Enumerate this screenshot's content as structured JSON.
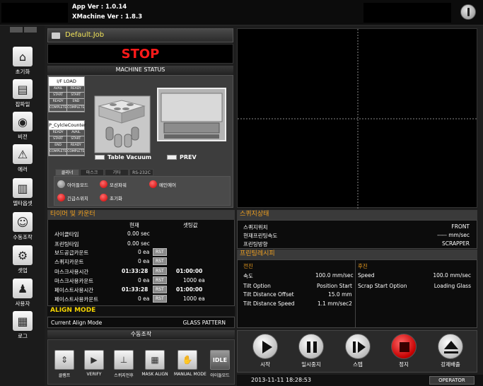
{
  "app": {
    "app_version": "App Ver : 1.0.14",
    "xmachine_version": "XMachine Ver : 1.8.3"
  },
  "sidebar": {
    "mini_left": "",
    "mini_right": "",
    "items": [
      {
        "label": "초기화",
        "icon": "home-icon"
      },
      {
        "label": "잡파일",
        "icon": "folder-icon"
      },
      {
        "label": "비전",
        "icon": "camera-icon"
      },
      {
        "label": "에러",
        "icon": "warning-icon"
      },
      {
        "label": "델타옵셋",
        "icon": "ruler-icon"
      },
      {
        "label": "수동조작",
        "icon": "user-hand-icon"
      },
      {
        "label": "셋업",
        "icon": "gear-icon"
      },
      {
        "label": "사용자",
        "icon": "user-icon"
      },
      {
        "label": "로그",
        "icon": "document-icon"
      }
    ]
  },
  "job": {
    "name": "Default.Job"
  },
  "status": {
    "text": "STOP",
    "color": "#ff1a1a"
  },
  "machine_status": {
    "title": "MACHINE STATUS",
    "if_load": {
      "title": "I/F LOAD",
      "cells": [
        "AVAIL",
        "READY",
        "START",
        "START",
        "READY",
        "END",
        "COMPLETE",
        "COMPLETE"
      ]
    },
    "cycle_counter": {
      "title": "P_CylcleCounter",
      "cells": [
        "READY",
        "AVAIL",
        "START",
        "START",
        "END",
        "READY",
        "COMPLETE",
        "COMPLETE"
      ]
    },
    "table_vacuum": "Table Vacuum",
    "prev": "PREV",
    "tabs": [
      "클리너",
      "마스크",
      "기타",
      "RS-232C"
    ],
    "switches": [
      {
        "label": "아이들모드",
        "state": "gray"
      },
      {
        "label": "모션파워",
        "state": "red"
      },
      {
        "label": "메인에어",
        "state": "red"
      },
      {
        "label": "긴급스위치",
        "state": "red"
      },
      {
        "label": "초기화",
        "state": "red"
      }
    ]
  },
  "timer": {
    "title": "타이머 및 카운터",
    "col_current": "현재",
    "col_setting": "셋팅값",
    "rst_label": "RST",
    "rows": [
      {
        "label": "사이클타임",
        "current": "0.00 sec",
        "setting": ""
      },
      {
        "label": "프린팅타임",
        "current": "0.00 sec",
        "setting": ""
      },
      {
        "label": "보드공급카운트",
        "current": "0 ea",
        "setting": ""
      },
      {
        "label": "스퀴지카운트",
        "current": "0 ea",
        "setting": ""
      },
      {
        "label": "마스크사용시간",
        "current": "01:33:28",
        "setting": "01:00:00"
      },
      {
        "label": "마스크사용카운트",
        "current": "0 ea",
        "setting": "1000 ea"
      },
      {
        "label": "페이스트사용시간",
        "current": "01:33:28",
        "setting": "01:00:00"
      },
      {
        "label": "페이스트사용카운트",
        "current": "0 ea",
        "setting": "1000 ea"
      }
    ]
  },
  "align": {
    "title": "ALIGN MODE",
    "label": "Current Align Mode",
    "value": "GLASS PATTERN"
  },
  "manual": {
    "title": "수동조작",
    "buttons": [
      "클램프",
      "VERIFY",
      "스퀴지전후",
      "MASK ALIGN",
      "MANUAL MODE",
      "아이들모드"
    ],
    "idle_icon_text": "IDLE"
  },
  "squeegee": {
    "title": "스퀴지상태",
    "rows": [
      {
        "label": "스퀴지위치",
        "value": "FRONT"
      },
      {
        "label": "현재프린팅속도",
        "value": "----- mm/sec"
      },
      {
        "label": "프린팅방향",
        "value": "SCRAPPER"
      }
    ]
  },
  "recipe": {
    "title": "프린팅레시피",
    "forward_title": "전진",
    "backward_title": "후진",
    "forward": [
      {
        "label": "속도",
        "value": "100.0 mm/sec"
      },
      {
        "label": "Tilt Option",
        "value": "Position Start"
      },
      {
        "label": "Tilt Distance Offset",
        "value": "15.0 mm"
      },
      {
        "label": "Tilt Distance Speed",
        "value": "1.1 mm/sec2"
      }
    ],
    "backward": [
      {
        "label": "Speed",
        "value": "100.0 mm/sec"
      },
      {
        "label": "Scrap Start Option",
        "value": "Loading Glass"
      }
    ]
  },
  "controls": {
    "buttons": [
      {
        "label": "시작",
        "icon": "play-icon"
      },
      {
        "label": "일시중지",
        "icon": "pause-icon"
      },
      {
        "label": "스텝",
        "icon": "step-icon"
      },
      {
        "label": "정지",
        "icon": "stop-icon"
      },
      {
        "label": "강제배출",
        "icon": "eject-icon"
      }
    ]
  },
  "statusbar": {
    "datetime": "2013-11-11 18:28:53",
    "user": "OPERATOR"
  }
}
